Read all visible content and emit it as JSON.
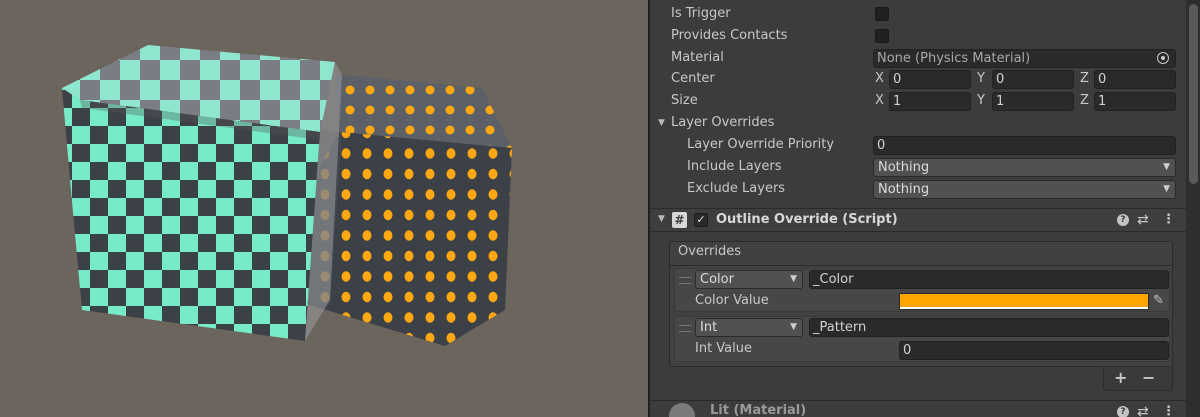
{
  "inspector": {
    "collider": {
      "is_trigger_label": "Is Trigger",
      "provides_contacts_label": "Provides Contacts",
      "material_label": "Material",
      "material_value": "None (Physics Material)",
      "center_label": "Center",
      "center": {
        "x_axis": "X",
        "x": "0",
        "y_axis": "Y",
        "y": "0",
        "z_axis": "Z",
        "z": "0"
      },
      "size_label": "Size",
      "size": {
        "x_axis": "X",
        "x": "1",
        "y_axis": "Y",
        "y": "1",
        "z_axis": "Z",
        "z": "1"
      },
      "layer_overrides_label": "Layer Overrides",
      "layer_override_priority_label": "Layer Override Priority",
      "layer_override_priority_value": "0",
      "include_layers_label": "Include Layers",
      "include_layers_value": "Nothing",
      "exclude_layers_label": "Exclude Layers",
      "exclude_layers_value": "Nothing"
    },
    "outline_override": {
      "title": "Outline Override (Script)",
      "hash_icon": "#",
      "overrides_label": "Overrides",
      "items": [
        {
          "type": "Color",
          "name": "_Color",
          "value_label": "Color Value",
          "color": "#ffa500"
        },
        {
          "type": "Int",
          "name": "_Pattern",
          "value_label": "Int Value",
          "value": "0"
        }
      ],
      "add_button": "+",
      "remove_button": "−"
    },
    "next_component": {
      "title": "Lit (Material)"
    }
  },
  "colors": {
    "checker_light": "#77ebc8",
    "checker_dark": "#3c4047",
    "dot_color": "#ffa812",
    "scene_bg": "#6c655d"
  }
}
